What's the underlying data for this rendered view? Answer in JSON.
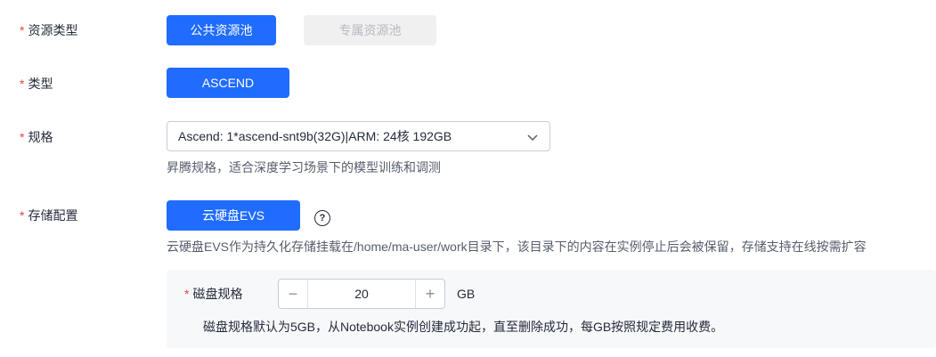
{
  "resource_type": {
    "label": "资源类型",
    "options": [
      "公共资源池",
      "专属资源池"
    ]
  },
  "type": {
    "label": "类型",
    "option": "ASCEND"
  },
  "spec": {
    "label": "规格",
    "selected": "Ascend: 1*ascend-snt9b(32G)|ARM: 24核 192GB",
    "hint": "昇腾规格，适合深度学习场景下的模型训练和调测"
  },
  "storage": {
    "label": "存储配置",
    "option": "云硬盘EVS",
    "help_glyph": "?",
    "hint": "云硬盘EVS作为持久化存储挂载在/home/ma-user/work目录下，该目录下的内容在实例停止后会被保留，存储支持在线按需扩容"
  },
  "disk": {
    "label": "磁盘规格",
    "value": "20",
    "minus": "−",
    "plus": "+",
    "unit": "GB",
    "hint": "磁盘规格默认为5GB，从Notebook实例创建成功起，直至删除成功，每GB按照规定费用收费。"
  },
  "required_mark": "*"
}
